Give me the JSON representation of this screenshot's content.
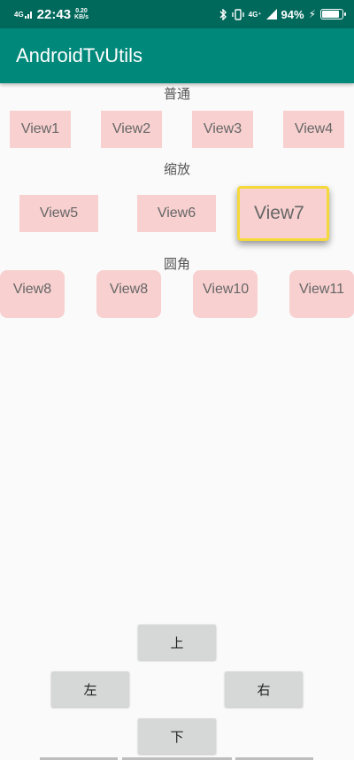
{
  "status_bar": {
    "network": "4G",
    "time": "22:43",
    "speed_value": "0.20",
    "speed_unit": "KB/s",
    "net_right": "4G⁺",
    "battery_text": "94%",
    "battery_level": 0.94
  },
  "app_bar": {
    "title": "AndroidTvUtils"
  },
  "sections": {
    "normal": {
      "title": "普通",
      "views": [
        "View1",
        "View2",
        "View3",
        "View4"
      ]
    },
    "scale": {
      "title": "缩放",
      "views": [
        "View5",
        "View6",
        "View7"
      ]
    },
    "round": {
      "title": "圆角",
      "views": [
        "View8",
        "View8",
        "View10",
        "View11"
      ]
    }
  },
  "dpad": {
    "up": "上",
    "left": "左",
    "right": "右",
    "down": "下"
  },
  "colors": {
    "status_bar": "#00695c",
    "app_bar": "#00897b",
    "tile": "#f8d0d0",
    "focus_border": "#f5d93a",
    "button": "#d6d7d7"
  }
}
